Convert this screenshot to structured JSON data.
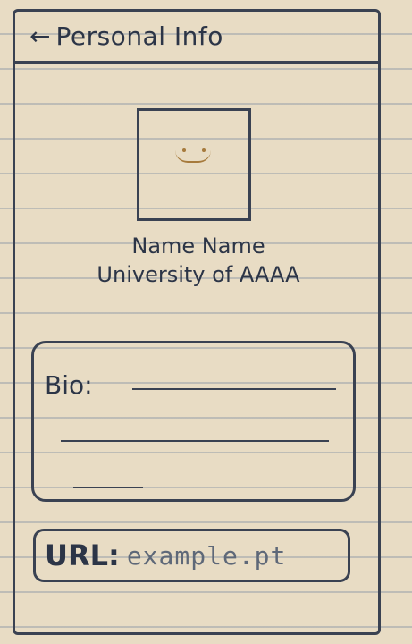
{
  "header": {
    "back_icon": "arrow-left-icon",
    "title": "Personal Info"
  },
  "profile": {
    "avatar_icon": "smiley-face-avatar",
    "name": "Name Name",
    "university": "University of AAAA"
  },
  "bio": {
    "label": "Bio:"
  },
  "url": {
    "label": "URL:",
    "value": "example.pt"
  },
  "colors": {
    "ink": "#3a4252",
    "paper": "#e8dcc4",
    "smiley": "#a67a3c"
  }
}
